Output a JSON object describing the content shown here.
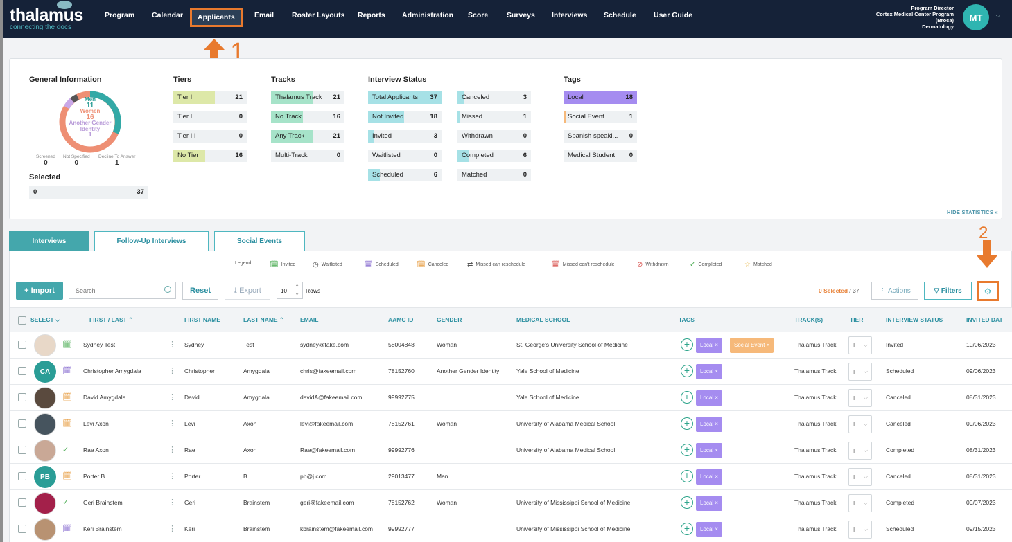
{
  "app": {
    "logo": "thalamus",
    "tagline": "connecting the docs"
  },
  "nav": [
    "Program",
    "Calendar",
    "Applicants",
    "Email",
    "Roster Layouts",
    "Reports",
    "Administration",
    "Score",
    "Surveys",
    "Interviews",
    "Schedule",
    "User Guide"
  ],
  "user": {
    "role": "Program Director",
    "program_line1": "Cortex Medical Center Program",
    "program_line2": "(Broca)",
    "program_line3": "Dermatology",
    "initials": "MT"
  },
  "annotations": {
    "step1": "1",
    "step2": "2"
  },
  "stats": {
    "general_title": "General Information",
    "donut": {
      "men_label": "Men",
      "men": "11",
      "women_label": "Women",
      "women": "16",
      "other_label1": "Another Gender",
      "other_label2": "Identity",
      "other": "1"
    },
    "donut_footer": [
      {
        "label": "Screened",
        "value": "0"
      },
      {
        "label": "Not Specified",
        "value": "0"
      },
      {
        "label": "Decline To Answer",
        "value": "1"
      }
    ],
    "selected_title": "Selected",
    "selected": {
      "left": "0",
      "right": "37"
    },
    "tiers_title": "Tiers",
    "tiers": [
      {
        "label": "Tier I",
        "value": "21"
      },
      {
        "label": "Tier II",
        "value": "0"
      },
      {
        "label": "Tier III",
        "value": "0"
      },
      {
        "label": "No Tier",
        "value": "16"
      }
    ],
    "tracks_title": "Tracks",
    "tracks": [
      {
        "label": "Thalamus Track",
        "value": "21"
      },
      {
        "label": "No Track",
        "value": "16"
      },
      {
        "label": "Any Track",
        "value": "21"
      },
      {
        "label": "Multi-Track",
        "value": "0"
      }
    ],
    "interview_title": "Interview Status",
    "interview_col1": [
      {
        "label": "Total Applicants",
        "value": "37"
      },
      {
        "label": "Not Invited",
        "value": "18"
      },
      {
        "label": "Invited",
        "value": "3"
      },
      {
        "label": "Waitlisted",
        "value": "0"
      },
      {
        "label": "Scheduled",
        "value": "6"
      }
    ],
    "interview_col2": [
      {
        "label": "Canceled",
        "value": "3"
      },
      {
        "label": "Missed",
        "value": "1"
      },
      {
        "label": "Withdrawn",
        "value": "0"
      },
      {
        "label": "Completed",
        "value": "6"
      },
      {
        "label": "Matched",
        "value": "0"
      }
    ],
    "tags_title": "Tags",
    "tags": [
      {
        "label": "Local",
        "value": "18"
      },
      {
        "label": "Social Event",
        "value": "1"
      },
      {
        "label": "Spanish speaki...",
        "value": "0"
      },
      {
        "label": "Medical Student",
        "value": "0"
      }
    ],
    "hide_label": "HIDE STATISTICS «"
  },
  "tabs": [
    "Interviews",
    "Follow-Up Interviews",
    "Social Events"
  ],
  "legend": {
    "title": "Legend",
    "items": [
      "Invited",
      "Waitlisted",
      "Scheduled",
      "Canceled",
      "Missed can reschedule",
      "Missed can't reschedule",
      "Withdrawn",
      "Completed",
      "Matched"
    ]
  },
  "toolbar": {
    "import": "+ Import",
    "search_placeholder": "Search",
    "reset": "Reset",
    "export": "Export",
    "rows_value": "10",
    "rows_label": "Rows",
    "selected_count": "0 Selected",
    "total": " / 37",
    "actions": "Actions",
    "filters": "Filters"
  },
  "columns": [
    "SELECT",
    "FIRST / LAST",
    "FIRST NAME",
    "LAST NAME",
    "EMAIL",
    "AAMC ID",
    "GENDER",
    "MEDICAL SCHOOL",
    "TAGS",
    "TRACK(S)",
    "TIER",
    "INTERVIEW STATUS",
    "INVITED DAT"
  ],
  "rows": [
    {
      "full": "Sydney Test",
      "first": "Sydney",
      "last": "Test",
      "email": "sydney@fake.com",
      "aamc": "58004848",
      "gender": "Woman",
      "school": "St. George's University School of Medicine",
      "tags": [
        "Local ×",
        "Social Event ×"
      ],
      "track": "Thalamus Track",
      "tier": "I",
      "status": "Invited",
      "date": "10/06/2023",
      "avatar": "",
      "avatar_color": "#e8d8c8",
      "icon": "invited"
    },
    {
      "full": "Christopher Amygdala",
      "first": "Christopher",
      "last": "Amygdala",
      "email": "chris@fakeemail.com",
      "aamc": "78152760",
      "gender": "Another Gender Identity",
      "school": "Yale School of Medicine",
      "tags": [
        "Local ×"
      ],
      "track": "Thalamus Track",
      "tier": "I",
      "status": "Scheduled",
      "date": "09/06/2023",
      "avatar": "CA",
      "avatar_color": "#2a9d96",
      "icon": "scheduled"
    },
    {
      "full": "David Amygdala",
      "first": "David",
      "last": "Amygdala",
      "email": "davidA@fakeemail.com",
      "aamc": "99992775",
      "gender": "",
      "school": "Yale School of Medicine",
      "tags": [
        "Local ×"
      ],
      "track": "Thalamus Track",
      "tier": "I",
      "status": "Canceled",
      "date": "08/31/2023",
      "avatar": "",
      "avatar_color": "#5a4a3e",
      "icon": "canceled"
    },
    {
      "full": "Levi Axon",
      "first": "Levi",
      "last": "Axon",
      "email": "levi@fakeemail.com",
      "aamc": "78152761",
      "gender": "Woman",
      "school": "University of Alabama Medical School",
      "tags": [
        "Local ×"
      ],
      "track": "Thalamus Track",
      "tier": "I",
      "status": "Canceled",
      "date": "09/06/2023",
      "avatar": "",
      "avatar_color": "#46545e",
      "icon": "canceled"
    },
    {
      "full": "Rae Axon",
      "first": "Rae",
      "last": "Axon",
      "email": "Rae@fakeemail.com",
      "aamc": "99992776",
      "gender": "",
      "school": "University of Alabama Medical School",
      "tags": [
        "Local ×"
      ],
      "track": "Thalamus Track",
      "tier": "I",
      "status": "Completed",
      "date": "08/31/2023",
      "avatar": "",
      "avatar_color": "#c9a896",
      "icon": "completed"
    },
    {
      "full": "Porter B",
      "first": "Porter",
      "last": "B",
      "email": "pb@j.com",
      "aamc": "29013477",
      "gender": "Man",
      "school": "",
      "tags": [
        "Local ×"
      ],
      "track": "Thalamus Track",
      "tier": "I",
      "status": "Canceled",
      "date": "08/31/2023",
      "avatar": "PB",
      "avatar_color": "#2a9d96",
      "icon": "canceled"
    },
    {
      "full": "Geri Brainstem",
      "first": "Geri",
      "last": "Brainstem",
      "email": "geri@fakeemail.com",
      "aamc": "78152762",
      "gender": "Woman",
      "school": "University of Mississippi School of Medicine",
      "tags": [
        "Local ×"
      ],
      "track": "Thalamus Track",
      "tier": "I",
      "status": "Completed",
      "date": "09/07/2023",
      "avatar": "",
      "avatar_color": "#a3204a",
      "icon": "completed"
    },
    {
      "full": "Keri Brainstem",
      "first": "Keri",
      "last": "Brainstem",
      "email": "kbrainstem@fakeemail.com",
      "aamc": "99992777",
      "gender": "",
      "school": "University of Mississippi School of Medicine",
      "tags": [
        "Local ×"
      ],
      "track": "Thalamus Track",
      "tier": "I",
      "status": "Scheduled",
      "date": "09/15/2023",
      "avatar": "",
      "avatar_color": "#b89272",
      "icon": "scheduled"
    }
  ],
  "colors": {
    "accent": "#44a7ac",
    "annotation": "#e87a2e",
    "nav_bg": "#152238",
    "tag_local": "#a58cf0",
    "tag_social": "#f6b97a",
    "tier_fill": "#dde8a8",
    "track_fill": "#a6e3c9",
    "interview_fill": "#a6e1e6",
    "tags_fill": "#a58cf0"
  }
}
